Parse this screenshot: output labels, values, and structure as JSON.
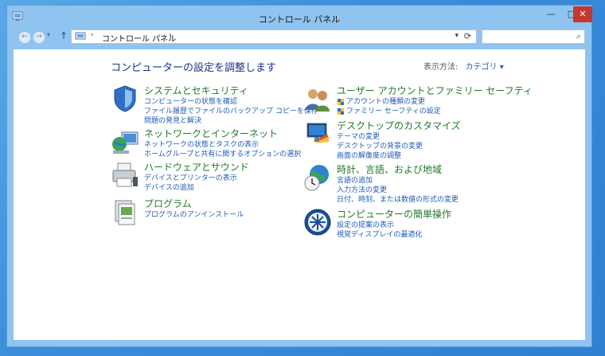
{
  "window": {
    "title": "コントロール パネル",
    "controls": {
      "minimize": "—",
      "maximize": "□",
      "close": "✕"
    }
  },
  "nav": {
    "back": "←",
    "forward": "→",
    "dropdown": "▾",
    "up": "↑",
    "address_sep1": "›",
    "address": "コントロール パネル",
    "address_sep2": "›",
    "address_dropdown": "▾",
    "refresh": "⟳",
    "search_placeholder": "",
    "search_icon": "⌕"
  },
  "content": {
    "heading": "コンピューターの設定を調整します",
    "view_by": {
      "label": "表示方法:",
      "value": "カテゴリ ▾"
    }
  },
  "categories_left": [
    {
      "icon": "security-shield-icon",
      "title": "システムとセキュリティ",
      "links": [
        {
          "text": "コンピューターの状態を確認"
        },
        {
          "text": "ファイル履歴でファイルのバックアップ コピーを保存"
        },
        {
          "text": "問題の発見と解決"
        }
      ]
    },
    {
      "icon": "network-globe-icon",
      "title": "ネットワークとインターネット",
      "links": [
        {
          "text": "ネットワークの状態とタスクの表示"
        },
        {
          "text": "ホームグループと共有に関するオプションの選択"
        }
      ]
    },
    {
      "icon": "printer-icon",
      "title": "ハードウェアとサウンド",
      "links": [
        {
          "text": "デバイスとプリンターの表示"
        },
        {
          "text": "デバイスの追加"
        }
      ]
    },
    {
      "icon": "programs-icon",
      "title": "プログラム",
      "links": [
        {
          "text": "プログラムのアンインストール"
        }
      ]
    }
  ],
  "categories_right": [
    {
      "icon": "users-icon",
      "title": "ユーザー アカウントとファミリー セーフティ",
      "links": [
        {
          "text": "アカウントの種類の変更",
          "shield": true
        },
        {
          "text": "ファミリー セーフティの設定",
          "shield": true
        }
      ]
    },
    {
      "icon": "desktop-display-icon",
      "title": "デスクトップのカスタマイズ",
      "links": [
        {
          "text": "テーマの変更"
        },
        {
          "text": "デスクトップの背景の変更"
        },
        {
          "text": "画面の解像度の調整"
        }
      ]
    },
    {
      "icon": "clock-globe-icon",
      "title": "時計、言語、および地域",
      "links": [
        {
          "text": "言語の追加"
        },
        {
          "text": "入力方法の変更"
        },
        {
          "text": "日付、時刻、または数値の形式の変更"
        }
      ]
    },
    {
      "icon": "ease-of-access-icon",
      "title": "コンピューターの簡単操作",
      "links": [
        {
          "text": "設定の提案の表示"
        },
        {
          "text": "視覚ディスプレイの最適化"
        }
      ]
    }
  ]
}
